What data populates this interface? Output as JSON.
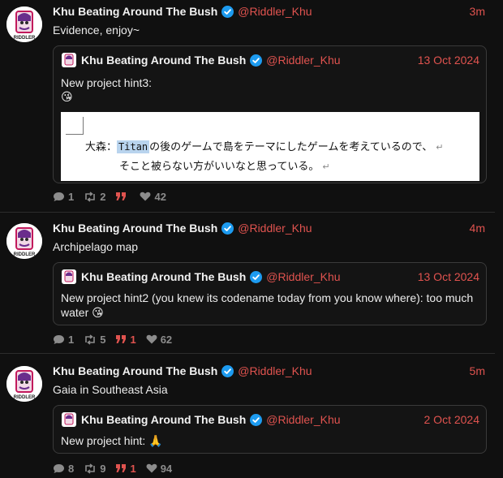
{
  "colors": {
    "accent": "#e0534f",
    "verified": "#1d9bf0",
    "background": "#101010"
  },
  "posts": [
    {
      "author": "Khu Beating Around The Bush",
      "handle": "@Riddler_Khu",
      "time": "3m",
      "text": "Evidence, enjoy~",
      "quote": {
        "author": "Khu Beating Around The Bush",
        "handle": "@Riddler_Khu",
        "date": "13 Oct 2024",
        "text": "New project hint3:",
        "emoji": "😘",
        "image": {
          "speaker": "大森：",
          "highlight": "Titan",
          "line1_rest": "の後のゲームで島をテーマにしたゲームを考えているので、",
          "line2": "そこと被らない方がいいなと思っている。",
          "return_mark": "↵"
        }
      },
      "actions": {
        "replies": "1",
        "reposts": "2",
        "quotes": "",
        "likes": "42"
      }
    },
    {
      "author": "Khu Beating Around The Bush",
      "handle": "@Riddler_Khu",
      "time": "4m",
      "text": "Archipelago map",
      "quote": {
        "author": "Khu Beating Around The Bush",
        "handle": "@Riddler_Khu",
        "date": "13 Oct 2024",
        "text": "New project hint2 (you knew its codename today from you know where): too much water 😘"
      },
      "actions": {
        "replies": "1",
        "reposts": "5",
        "quotes": "1",
        "likes": "62"
      }
    },
    {
      "author": "Khu Beating Around The Bush",
      "handle": "@Riddler_Khu",
      "time": "5m",
      "text": "Gaia in Southeast Asia",
      "quote": {
        "author": "Khu Beating Around The Bush",
        "handle": "@Riddler_Khu",
        "date": "2 Oct 2024",
        "text": "New project hint: 🙏"
      },
      "actions": {
        "replies": "8",
        "reposts": "9",
        "quotes": "1",
        "likes": "94"
      }
    }
  ],
  "avatar_label": "RIDDLER"
}
